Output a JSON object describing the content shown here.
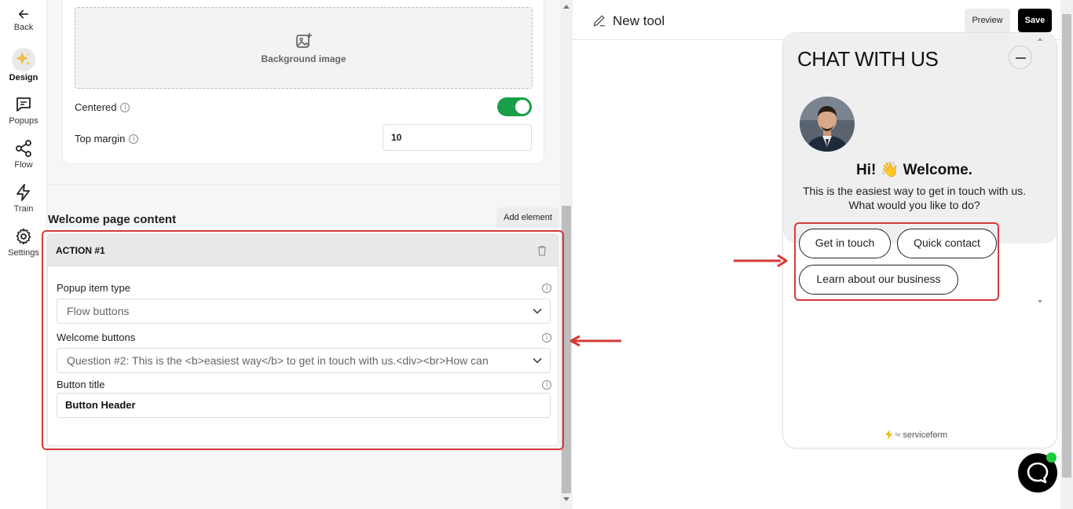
{
  "rail": {
    "back": "Back",
    "items": [
      {
        "label": "Design",
        "icon": "sparkles-icon"
      },
      {
        "label": "Popups",
        "icon": "chat-bubble-icon"
      },
      {
        "label": "Flow",
        "icon": "share-nodes-icon"
      },
      {
        "label": "Train",
        "icon": "lightning-icon"
      },
      {
        "label": "Settings",
        "icon": "gear-icon"
      }
    ]
  },
  "panel": {
    "background_image_label": "Background image",
    "centered_label": "Centered",
    "centered_on": true,
    "top_margin_label": "Top margin",
    "top_margin_value": "10",
    "section_title": "Welcome page content",
    "add_element": "Add element",
    "action": {
      "title": "ACTION #1",
      "popup_item_type_label": "Popup item type",
      "popup_item_type_value": "Flow buttons",
      "welcome_buttons_label": "Welcome buttons",
      "welcome_buttons_value": "Question #2: This is the <b>easiest way</b> to get in touch with us.<div><br>How can",
      "button_title_label": "Button title",
      "button_title_value": "Button Header"
    }
  },
  "preview": {
    "tool_name": "New tool",
    "preview_button": "Preview",
    "save_button": "Save",
    "widget": {
      "title": "CHAT WITH US",
      "greeting": "Hi! 👋 Welcome.",
      "subtitle": "This is the easiest way to get in touch with us. What would you like to do?",
      "buttons": [
        "Get in touch",
        "Quick contact",
        "Learn about our business"
      ],
      "powered_by": "servicefөrm",
      "powered_prefix": "by"
    }
  },
  "colors": {
    "accent_green": "#1a9e4a",
    "highlight_red": "#d53a3a",
    "status_green": "#1bcc3e"
  }
}
